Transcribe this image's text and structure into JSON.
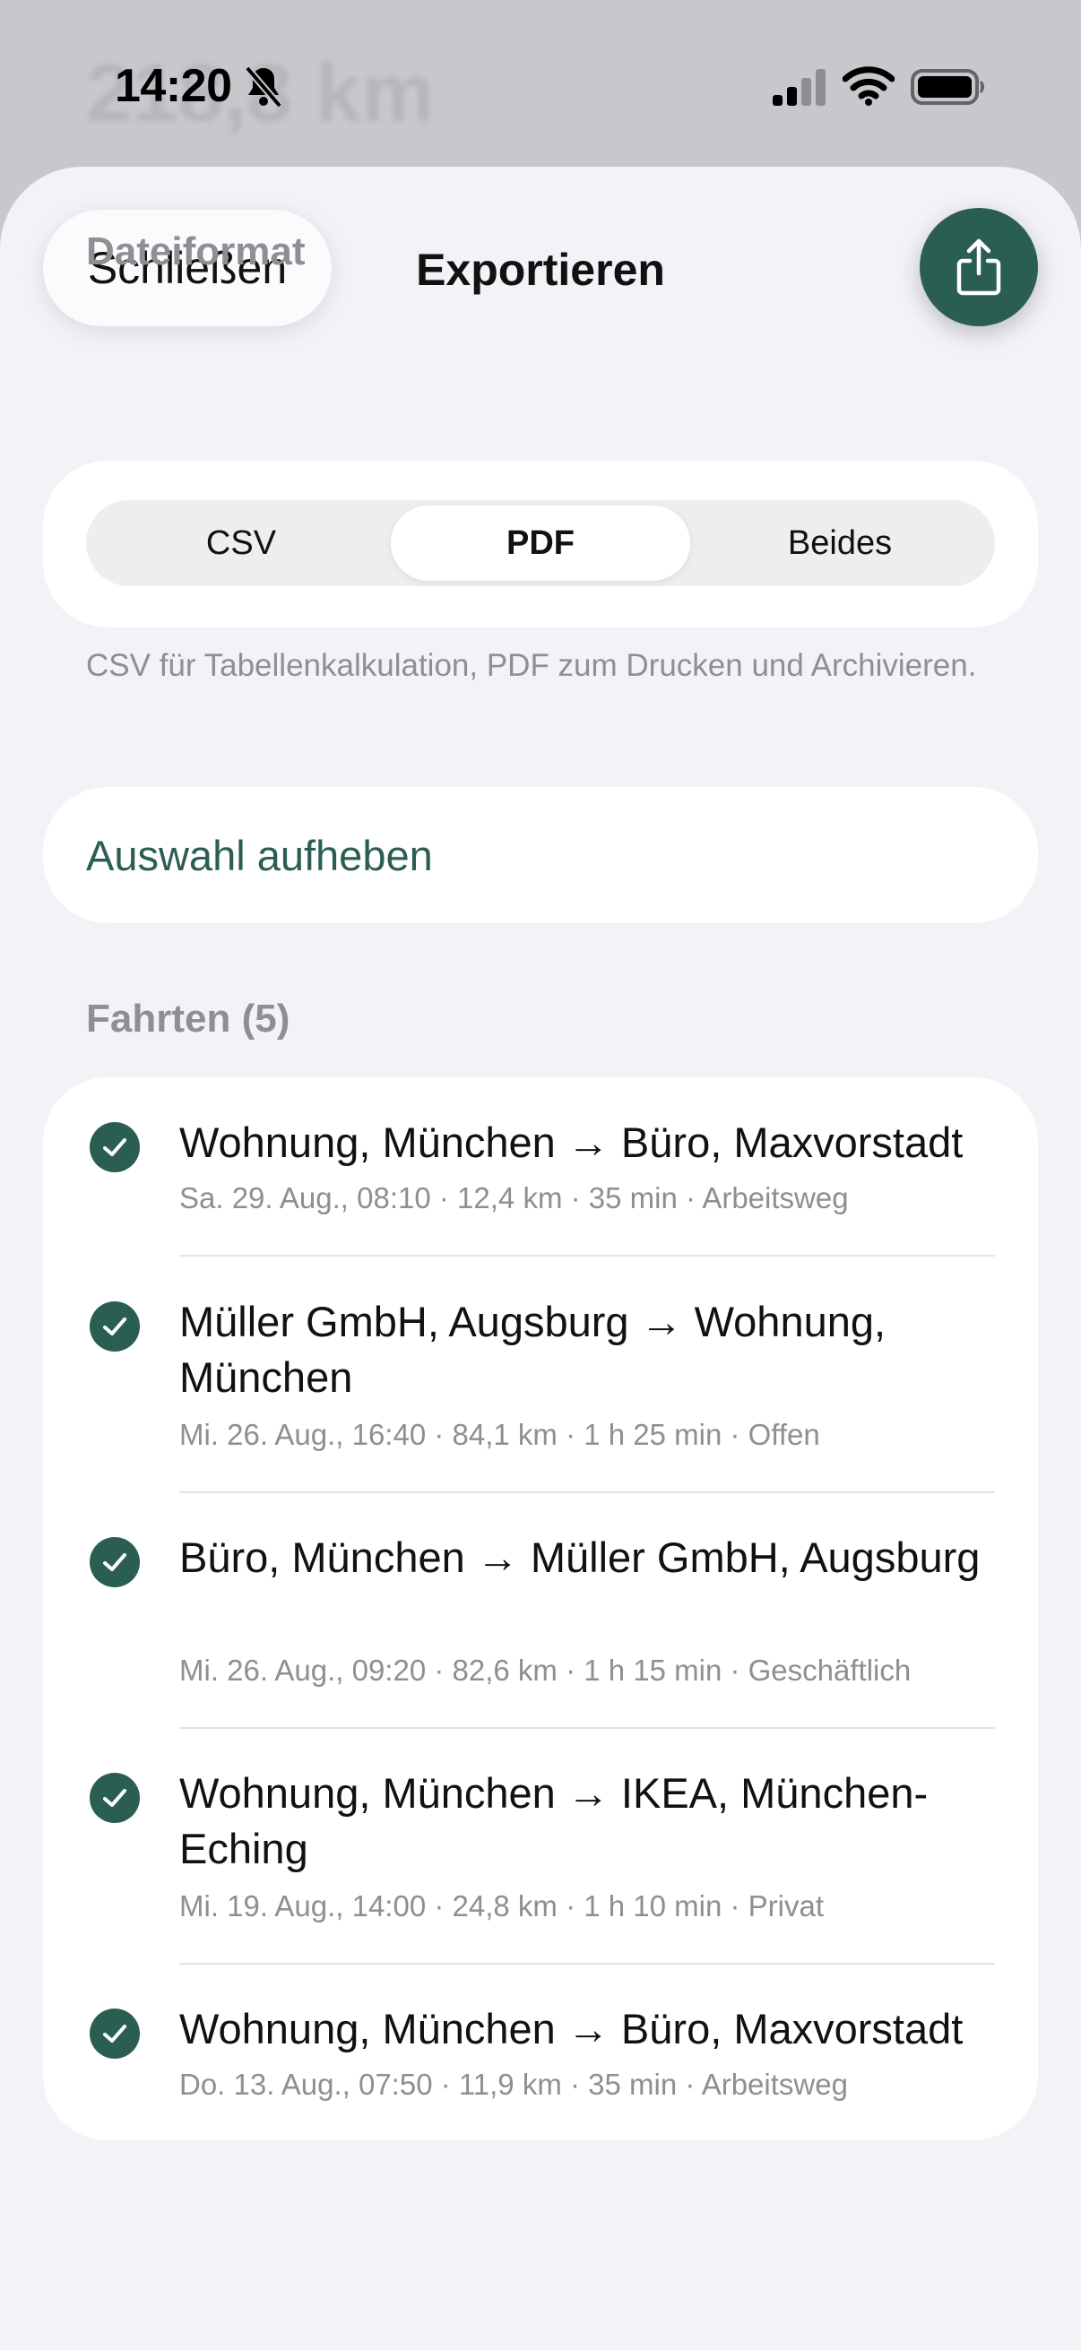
{
  "background": {
    "peek_text": "218,8 km"
  },
  "status_bar": {
    "time": "14:20"
  },
  "sheet": {
    "close_label": "Schließen",
    "title": "Exportieren"
  },
  "format": {
    "header": "Dateiformat",
    "options": [
      "CSV",
      "PDF",
      "Beides"
    ],
    "selected": "PDF",
    "footnote": "CSV für Tabellenkalkulation, PDF zum Drucken und Archivieren."
  },
  "selection": {
    "deselect_label": "Auswahl aufheben"
  },
  "trips": {
    "header": "Fahrten (5)",
    "items": [
      {
        "title": "Wohnung, München → Büro, Maxvorstadt",
        "meta": "Sa. 29. Aug., 08:10 · 12,4 km · 35 min · Arbeitsweg",
        "checked": true
      },
      {
        "title": "Müller GmbH, Augsburg → Wohnung, München",
        "meta": "Mi. 26. Aug., 16:40 · 84,1 km · 1 h 25 min · Offen",
        "checked": true
      },
      {
        "title": "Büro, München → Müller GmbH, Augsburg",
        "meta": "Mi. 26. Aug., 09:20 · 82,6 km · 1 h 15 min · Geschäftlich",
        "checked": true
      },
      {
        "title": "Wohnung, München → IKEA, München-Eching",
        "meta": "Mi. 19. Aug., 14:00 · 24,8 km · 1 h 10 min · Privat",
        "checked": true
      },
      {
        "title": "Wohnung, München → Büro, Maxvorstadt",
        "meta": "Do. 13. Aug., 07:50 · 11,9 km · 35 min · Arbeitsweg",
        "checked": true
      }
    ]
  },
  "colors": {
    "accent": "#2b5e53",
    "sheet_background": "#f2f2f7",
    "secondary_text": "#8e8e93"
  },
  "icons": {
    "share": "share-icon",
    "check": "checkmark-circle-icon",
    "silent": "bell-slash-icon"
  }
}
